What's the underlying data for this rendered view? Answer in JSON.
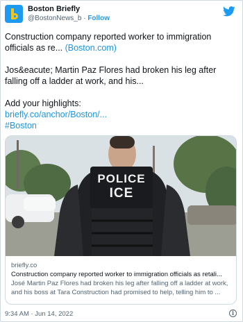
{
  "account": {
    "display_name": "Boston Briefly",
    "handle": "@BostonNews_b",
    "separator": " · ",
    "follow_label": "Follow",
    "avatar_icon": "briefly-b-logo",
    "brand_color": "#1d9bf0"
  },
  "platform_icon": "twitter-bird-icon",
  "tweet": {
    "line1_text": "Construction company reported worker to immigration officials as re... ",
    "line1_link": "(Boston.com)",
    "line2_text": "Jos&eacute; Martin Paz Flores had broken his leg after falling off a ladder at work, and his...",
    "line3_text": "Add your highlights:",
    "line3_link": "briefly.co/anchor/Boston/...",
    "hashtag": " #Boston",
    "link_color": "#1b95e0"
  },
  "card": {
    "image_description_icon": "police-ice-officer-photo",
    "vest_line1": "POLICE",
    "vest_line2": "ICE",
    "domain": "briefly.co",
    "title": "Construction company reported worker to immigration officials as retali...",
    "description": "José Martin Paz Flores had broken his leg after falling off a ladder at work, and his boss at Tara Construction had promised to help, telling him to ..."
  },
  "footer": {
    "timestamp": "9:34 AM · Jun 14, 2022",
    "info_icon": "info-icon"
  }
}
